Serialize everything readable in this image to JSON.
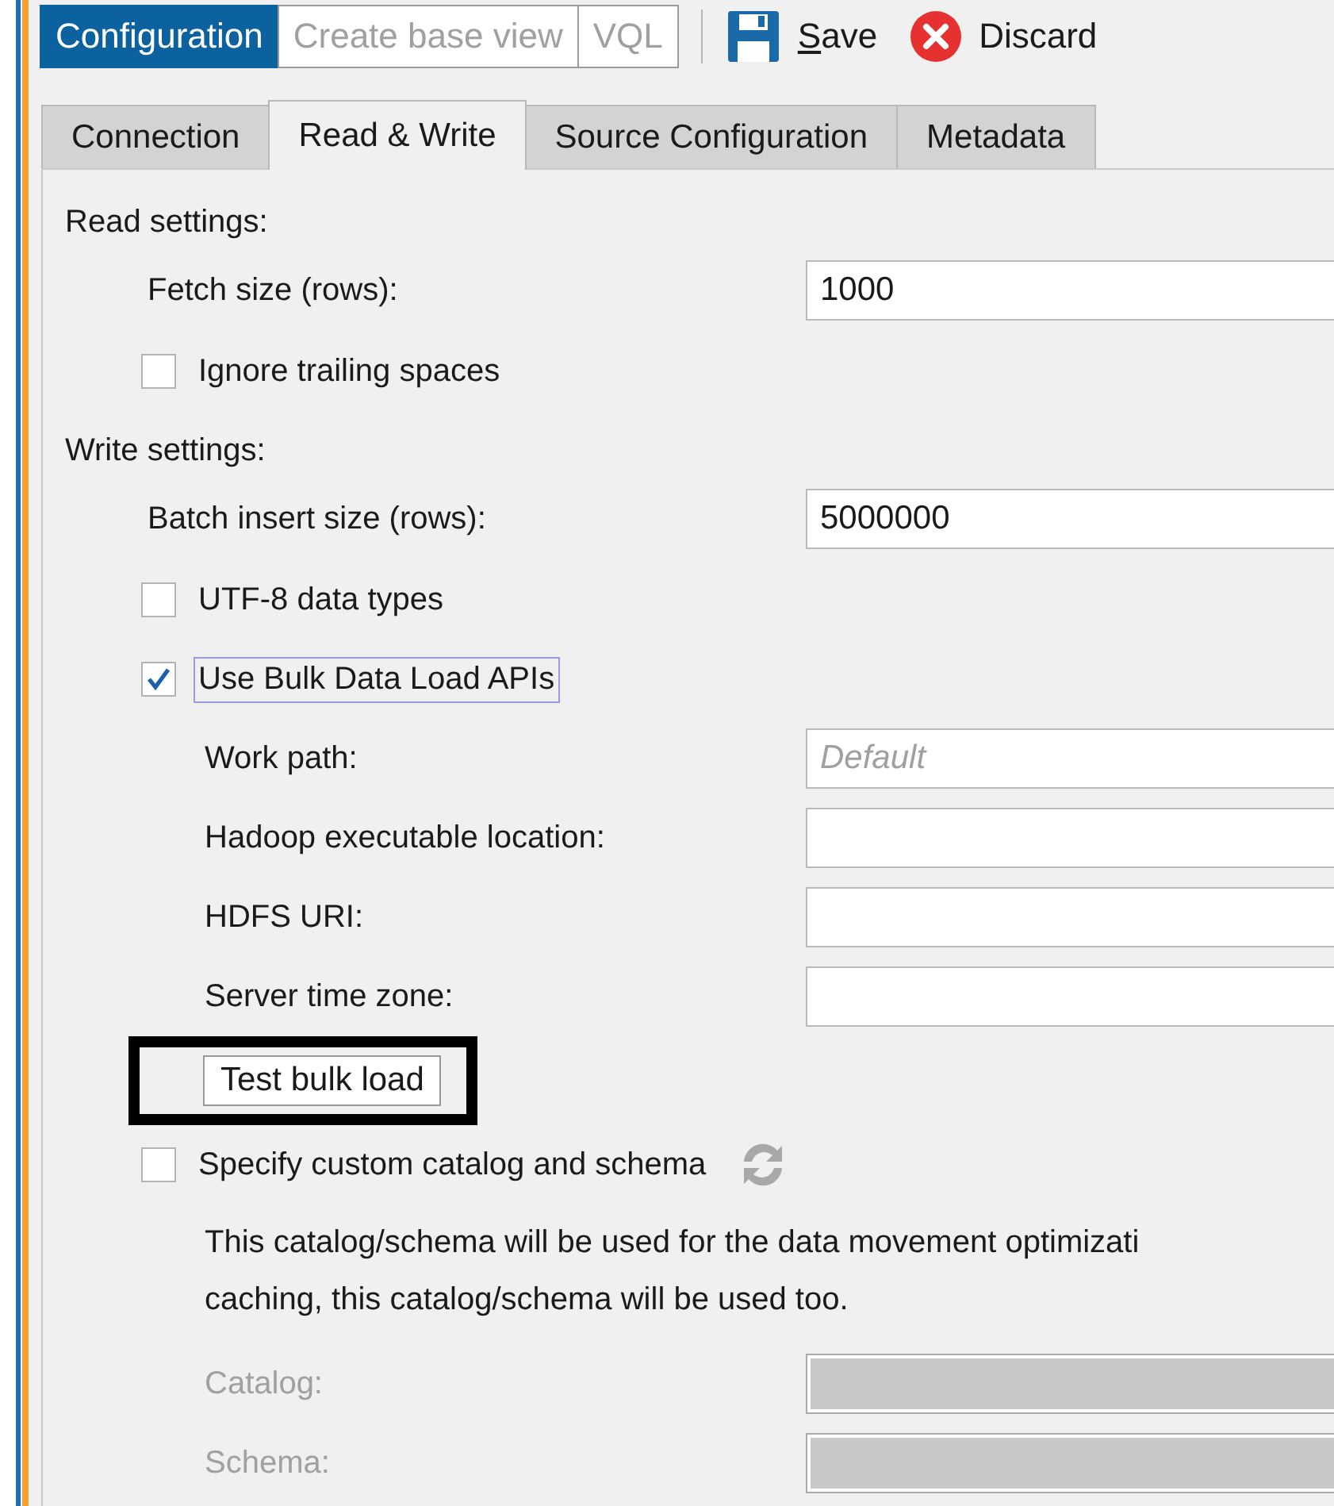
{
  "toolbar": {
    "modes": [
      {
        "label": "Configuration",
        "selected": true
      },
      {
        "label": "Create base view",
        "selected": false
      },
      {
        "label": "VQL",
        "selected": false
      }
    ],
    "actions": [
      {
        "kind": "save",
        "label": "Save",
        "mnemonic_underlined": true
      },
      {
        "kind": "discard",
        "label": "Discard",
        "mnemonic_underlined": false
      }
    ]
  },
  "tabs": [
    {
      "label": "Connection",
      "selected": false
    },
    {
      "label": "Read & Write",
      "selected": true
    },
    {
      "label": "Source Configuration",
      "selected": false
    },
    {
      "label": "Metadata",
      "selected": false
    }
  ],
  "sections": [
    {
      "title": "Read settings:",
      "items": [
        {
          "kind": "field",
          "label": "Fetch size (rows):",
          "value": "1000",
          "disabled": false
        },
        {
          "kind": "checkbox",
          "label": "Ignore trailing spaces",
          "checked": false,
          "focused": false
        }
      ]
    },
    {
      "title": "Write settings:",
      "items": [
        {
          "kind": "field",
          "label": "Batch insert size (rows):",
          "value": "5000000",
          "disabled": false
        },
        {
          "kind": "checkbox",
          "label": "UTF-8 data types",
          "checked": false,
          "focused": false
        },
        {
          "kind": "checkbox",
          "label": "Use Bulk Data Load APIs",
          "checked": true,
          "focused": true,
          "children": [
            {
              "kind": "field",
              "label": "Work path:",
              "placeholder": "Default",
              "disabled": false
            },
            {
              "kind": "field",
              "label": "Hadoop executable location:",
              "disabled": false
            },
            {
              "kind": "field",
              "label": "HDFS URI:",
              "disabled": false
            },
            {
              "kind": "field",
              "label": "Server time zone:",
              "disabled": false
            },
            {
              "kind": "button",
              "label": "Test bulk load",
              "highlighted": true
            }
          ]
        },
        {
          "kind": "checkbox",
          "label": "Specify custom catalog and schema",
          "checked": false,
          "focused": false,
          "refresh": true,
          "children": [
            {
              "kind": "note",
              "text": "This catalog/schema will be used for the data movement optimizati\ncaching, this catalog/schema will be used too."
            },
            {
              "kind": "field",
              "label": "Catalog:",
              "disabled": true
            },
            {
              "kind": "field",
              "label": "Schema:",
              "disabled": true
            }
          ]
        }
      ]
    }
  ]
}
